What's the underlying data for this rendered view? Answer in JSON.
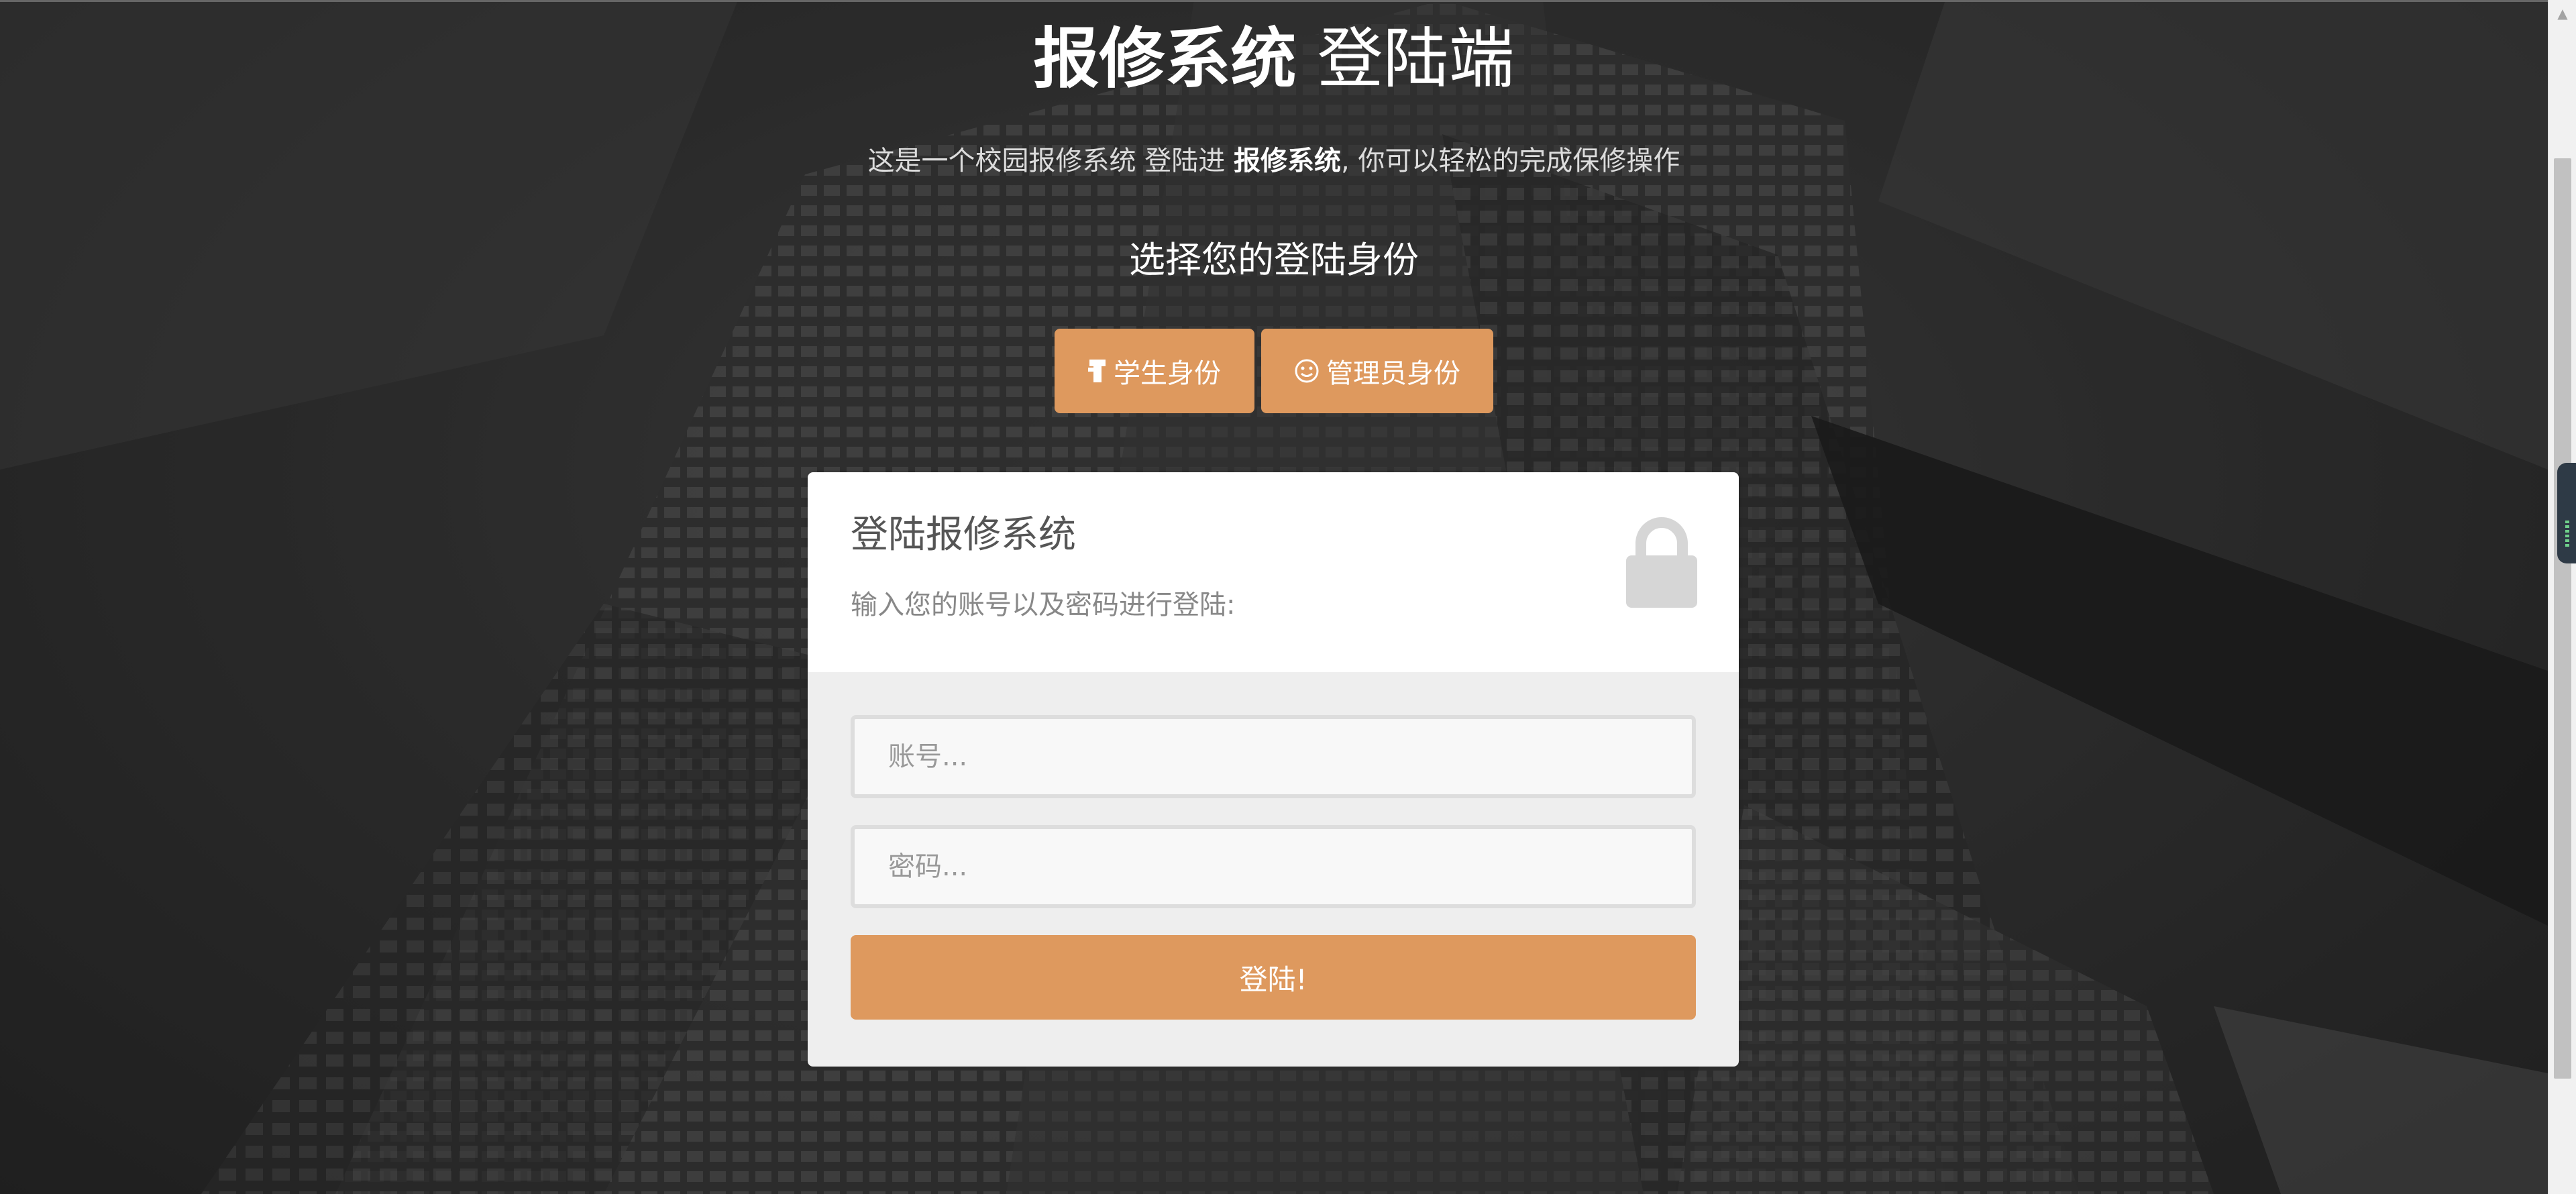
{
  "header": {
    "title_bold": "报修系统",
    "title_rest": " 登陆端",
    "subtitle_before": "这是一个校园报修系统 登陆进 ",
    "subtitle_bold": "报修系统",
    "subtitle_after": ", 你可以轻松的完成保修操作",
    "choose_role": "选择您的登陆身份"
  },
  "roles": {
    "student_label": "学生身份",
    "student_icon": "student-icon",
    "admin_label": "管理员身份",
    "admin_icon": "smiley-icon"
  },
  "login_card": {
    "title": "登陆报修系统",
    "description": "输入您的账号以及密码进行登陆:",
    "icon": "lock-icon",
    "account_placeholder": "账号...",
    "account_value": "",
    "password_placeholder": "密码...",
    "password_value": "",
    "submit_label": "登陆!"
  },
  "colors": {
    "accent": "#de995e",
    "card_bg": "#ffffff",
    "form_bg": "#eeeeee"
  }
}
